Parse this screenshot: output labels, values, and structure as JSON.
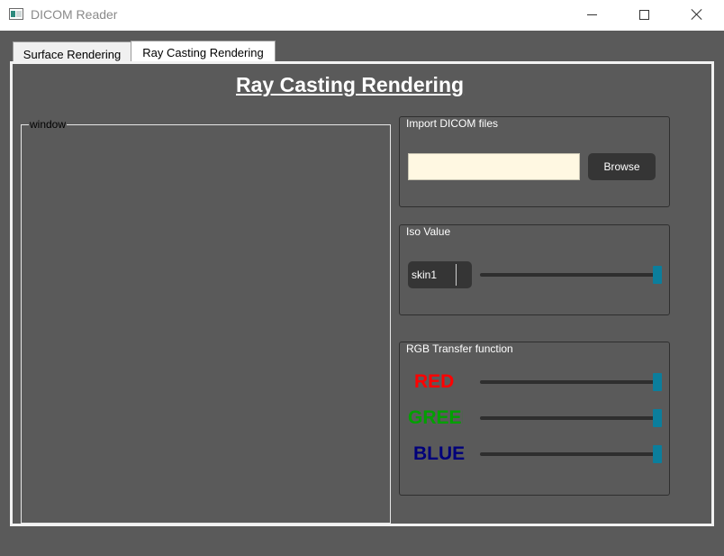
{
  "window": {
    "title": "DICOM Reader",
    "app_icon": "dicom-app-icon",
    "controls": [
      "minimize-icon",
      "maximize-icon",
      "close-icon"
    ]
  },
  "tabs": [
    {
      "label": "Surface Rendering",
      "active": false
    },
    {
      "label": "Ray Casting Rendering",
      "active": true
    }
  ],
  "page": {
    "title": "Ray Casting Rendering"
  },
  "render_window": {
    "label": "window"
  },
  "import_group": {
    "title": "Import DICOM files",
    "path_value": "",
    "browse_label": "Browse"
  },
  "iso_group": {
    "title": "Iso Value",
    "preset_value": "skin1",
    "slider_level": 1.0
  },
  "rgb_group": {
    "title": "RGB Transfer function",
    "channels": [
      {
        "label": "RED",
        "color": "#ff0000",
        "level": 1.0
      },
      {
        "label": "GREEN",
        "color": "#00a000",
        "level": 1.0
      },
      {
        "label": "BLUE",
        "color": "#00007a",
        "level": 1.0
      }
    ]
  },
  "colors": {
    "background": "#5a5a5a",
    "slider_handle": "#0b7e9c",
    "input_background": "#fff8e2",
    "button_background": "#353535"
  }
}
